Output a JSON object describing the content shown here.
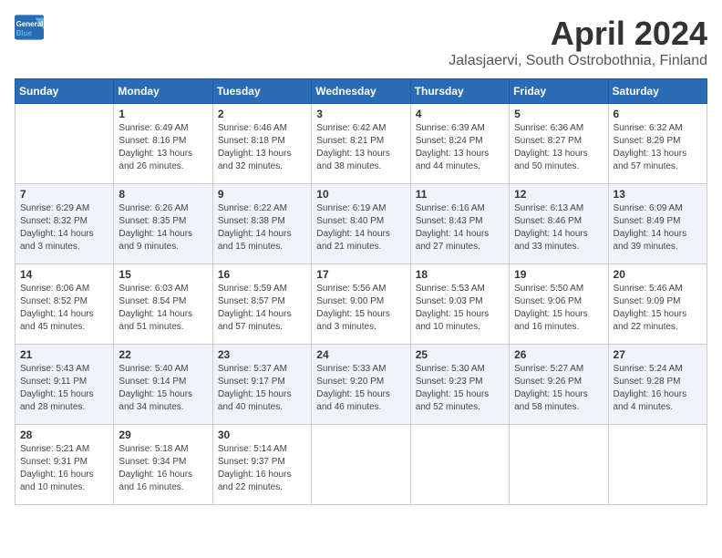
{
  "logo": {
    "text_general": "General",
    "text_blue": "Blue"
  },
  "title": "April 2024",
  "location": "Jalasjaervi, South Ostrobothnia, Finland",
  "weekdays": [
    "Sunday",
    "Monday",
    "Tuesday",
    "Wednesday",
    "Thursday",
    "Friday",
    "Saturday"
  ],
  "weeks": [
    [
      {
        "day": "",
        "sunrise": "",
        "sunset": "",
        "daylight": ""
      },
      {
        "day": "1",
        "sunrise": "Sunrise: 6:49 AM",
        "sunset": "Sunset: 8:16 PM",
        "daylight": "Daylight: 13 hours and 26 minutes."
      },
      {
        "day": "2",
        "sunrise": "Sunrise: 6:46 AM",
        "sunset": "Sunset: 8:18 PM",
        "daylight": "Daylight: 13 hours and 32 minutes."
      },
      {
        "day": "3",
        "sunrise": "Sunrise: 6:42 AM",
        "sunset": "Sunset: 8:21 PM",
        "daylight": "Daylight: 13 hours and 38 minutes."
      },
      {
        "day": "4",
        "sunrise": "Sunrise: 6:39 AM",
        "sunset": "Sunset: 8:24 PM",
        "daylight": "Daylight: 13 hours and 44 minutes."
      },
      {
        "day": "5",
        "sunrise": "Sunrise: 6:36 AM",
        "sunset": "Sunset: 8:27 PM",
        "daylight": "Daylight: 13 hours and 50 minutes."
      },
      {
        "day": "6",
        "sunrise": "Sunrise: 6:32 AM",
        "sunset": "Sunset: 8:29 PM",
        "daylight": "Daylight: 13 hours and 57 minutes."
      }
    ],
    [
      {
        "day": "7",
        "sunrise": "Sunrise: 6:29 AM",
        "sunset": "Sunset: 8:32 PM",
        "daylight": "Daylight: 14 hours and 3 minutes."
      },
      {
        "day": "8",
        "sunrise": "Sunrise: 6:26 AM",
        "sunset": "Sunset: 8:35 PM",
        "daylight": "Daylight: 14 hours and 9 minutes."
      },
      {
        "day": "9",
        "sunrise": "Sunrise: 6:22 AM",
        "sunset": "Sunset: 8:38 PM",
        "daylight": "Daylight: 14 hours and 15 minutes."
      },
      {
        "day": "10",
        "sunrise": "Sunrise: 6:19 AM",
        "sunset": "Sunset: 8:40 PM",
        "daylight": "Daylight: 14 hours and 21 minutes."
      },
      {
        "day": "11",
        "sunrise": "Sunrise: 6:16 AM",
        "sunset": "Sunset: 8:43 PM",
        "daylight": "Daylight: 14 hours and 27 minutes."
      },
      {
        "day": "12",
        "sunrise": "Sunrise: 6:13 AM",
        "sunset": "Sunset: 8:46 PM",
        "daylight": "Daylight: 14 hours and 33 minutes."
      },
      {
        "day": "13",
        "sunrise": "Sunrise: 6:09 AM",
        "sunset": "Sunset: 8:49 PM",
        "daylight": "Daylight: 14 hours and 39 minutes."
      }
    ],
    [
      {
        "day": "14",
        "sunrise": "Sunrise: 6:06 AM",
        "sunset": "Sunset: 8:52 PM",
        "daylight": "Daylight: 14 hours and 45 minutes."
      },
      {
        "day": "15",
        "sunrise": "Sunrise: 6:03 AM",
        "sunset": "Sunset: 8:54 PM",
        "daylight": "Daylight: 14 hours and 51 minutes."
      },
      {
        "day": "16",
        "sunrise": "Sunrise: 5:59 AM",
        "sunset": "Sunset: 8:57 PM",
        "daylight": "Daylight: 14 hours and 57 minutes."
      },
      {
        "day": "17",
        "sunrise": "Sunrise: 5:56 AM",
        "sunset": "Sunset: 9:00 PM",
        "daylight": "Daylight: 15 hours and 3 minutes."
      },
      {
        "day": "18",
        "sunrise": "Sunrise: 5:53 AM",
        "sunset": "Sunset: 9:03 PM",
        "daylight": "Daylight: 15 hours and 10 minutes."
      },
      {
        "day": "19",
        "sunrise": "Sunrise: 5:50 AM",
        "sunset": "Sunset: 9:06 PM",
        "daylight": "Daylight: 15 hours and 16 minutes."
      },
      {
        "day": "20",
        "sunrise": "Sunrise: 5:46 AM",
        "sunset": "Sunset: 9:09 PM",
        "daylight": "Daylight: 15 hours and 22 minutes."
      }
    ],
    [
      {
        "day": "21",
        "sunrise": "Sunrise: 5:43 AM",
        "sunset": "Sunset: 9:11 PM",
        "daylight": "Daylight: 15 hours and 28 minutes."
      },
      {
        "day": "22",
        "sunrise": "Sunrise: 5:40 AM",
        "sunset": "Sunset: 9:14 PM",
        "daylight": "Daylight: 15 hours and 34 minutes."
      },
      {
        "day": "23",
        "sunrise": "Sunrise: 5:37 AM",
        "sunset": "Sunset: 9:17 PM",
        "daylight": "Daylight: 15 hours and 40 minutes."
      },
      {
        "day": "24",
        "sunrise": "Sunrise: 5:33 AM",
        "sunset": "Sunset: 9:20 PM",
        "daylight": "Daylight: 15 hours and 46 minutes."
      },
      {
        "day": "25",
        "sunrise": "Sunrise: 5:30 AM",
        "sunset": "Sunset: 9:23 PM",
        "daylight": "Daylight: 15 hours and 52 minutes."
      },
      {
        "day": "26",
        "sunrise": "Sunrise: 5:27 AM",
        "sunset": "Sunset: 9:26 PM",
        "daylight": "Daylight: 15 hours and 58 minutes."
      },
      {
        "day": "27",
        "sunrise": "Sunrise: 5:24 AM",
        "sunset": "Sunset: 9:28 PM",
        "daylight": "Daylight: 16 hours and 4 minutes."
      }
    ],
    [
      {
        "day": "28",
        "sunrise": "Sunrise: 5:21 AM",
        "sunset": "Sunset: 9:31 PM",
        "daylight": "Daylight: 16 hours and 10 minutes."
      },
      {
        "day": "29",
        "sunrise": "Sunrise: 5:18 AM",
        "sunset": "Sunset: 9:34 PM",
        "daylight": "Daylight: 16 hours and 16 minutes."
      },
      {
        "day": "30",
        "sunrise": "Sunrise: 5:14 AM",
        "sunset": "Sunset: 9:37 PM",
        "daylight": "Daylight: 16 hours and 22 minutes."
      },
      {
        "day": "",
        "sunrise": "",
        "sunset": "",
        "daylight": ""
      },
      {
        "day": "",
        "sunrise": "",
        "sunset": "",
        "daylight": ""
      },
      {
        "day": "",
        "sunrise": "",
        "sunset": "",
        "daylight": ""
      },
      {
        "day": "",
        "sunrise": "",
        "sunset": "",
        "daylight": ""
      }
    ]
  ]
}
